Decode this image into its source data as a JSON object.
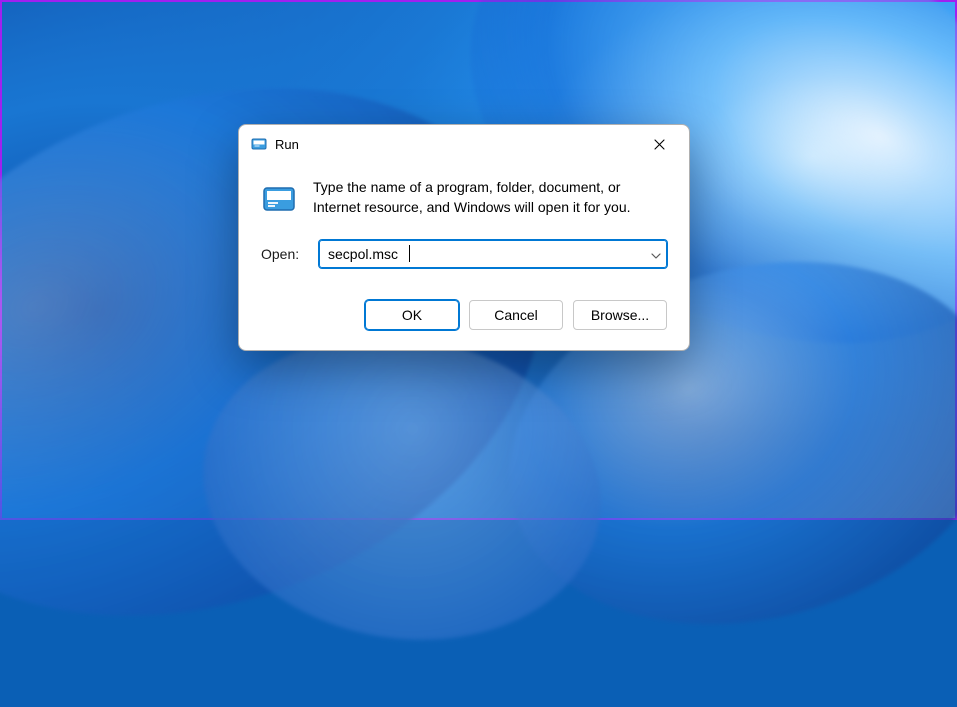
{
  "colors": {
    "accent": "#0078d4",
    "border_frame": "#a020f0"
  },
  "dialog": {
    "title": "Run",
    "description": "Type the name of a program, folder, document, or Internet resource, and Windows will open it for you.",
    "open_label": "Open:",
    "open_value": "secpol.msc",
    "buttons": {
      "ok": "OK",
      "cancel": "Cancel",
      "browse": "Browse..."
    },
    "icons": {
      "title_icon": "run-app-icon",
      "body_icon": "run-program-icon",
      "close": "close-icon",
      "dropdown": "chevron-down-icon"
    }
  }
}
